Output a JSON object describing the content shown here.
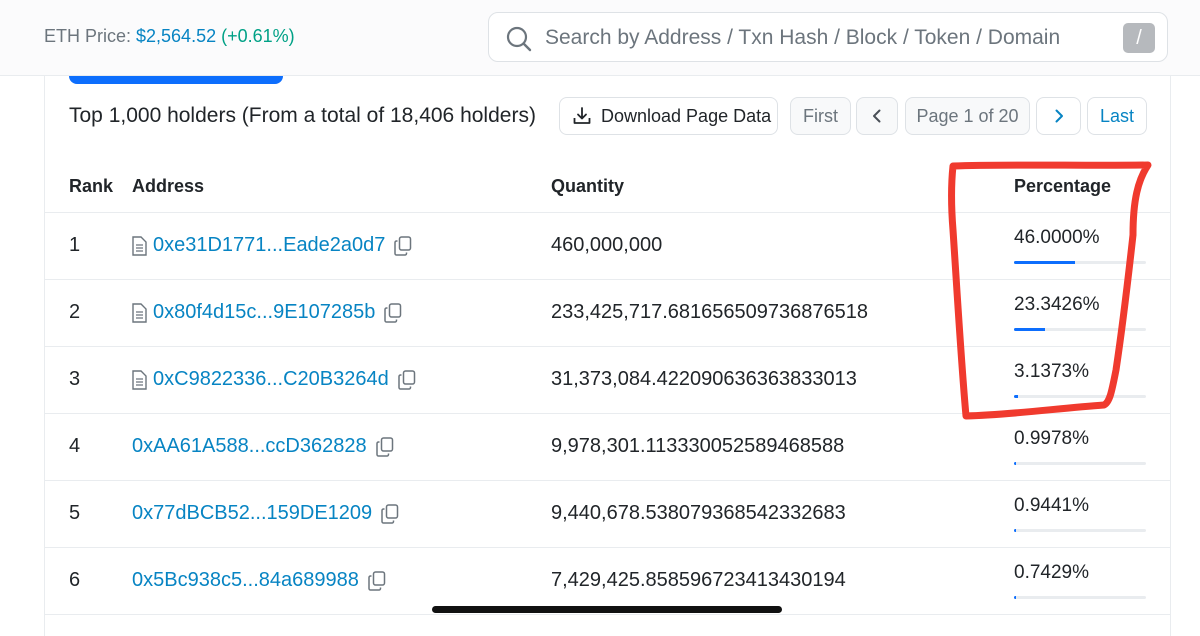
{
  "header": {
    "eth_price_label": "ETH Price: ",
    "eth_price_value": "$2,564.52",
    "eth_price_change": "(+0.61%)",
    "search_placeholder": "Search by Address / Txn Hash / Block / Token / Domain Name",
    "search_shortcut": "/"
  },
  "holders": {
    "summary": "Top 1,000 holders (From a total of 18,406 holders)",
    "download_label": "Download Page Data",
    "pagination": {
      "first": "First",
      "page_info": "Page 1 of 20",
      "last": "Last"
    },
    "columns": {
      "rank": "Rank",
      "address": "Address",
      "quantity": "Quantity",
      "percentage": "Percentage"
    },
    "rows": [
      {
        "rank": "1",
        "address": "0xe31D1771...Eade2a0d7",
        "is_contract": true,
        "quantity": "460,000,000",
        "percentage": "46.0000%",
        "pct_value": 46.0
      },
      {
        "rank": "2",
        "address": "0x80f4d15c...9E107285b",
        "is_contract": true,
        "quantity": "233,425,717.681656509736876518",
        "percentage": "23.3426%",
        "pct_value": 23.3426
      },
      {
        "rank": "3",
        "address": "0xC9822336...C20B3264d",
        "is_contract": true,
        "quantity": "31,373,084.422090636363833013",
        "percentage": "3.1373%",
        "pct_value": 3.1373
      },
      {
        "rank": "4",
        "address": "0xAA61A588...ccD362828",
        "is_contract": false,
        "quantity": "9,978,301.113330052589468588",
        "percentage": "0.9978%",
        "pct_value": 0.9978
      },
      {
        "rank": "5",
        "address": "0x77dBCB52...159DE1209",
        "is_contract": false,
        "quantity": "9,440,678.538079368542332683",
        "percentage": "0.9441%",
        "pct_value": 0.9441
      },
      {
        "rank": "6",
        "address": "0x5Bc938c5...84a689988",
        "is_contract": false,
        "quantity": "7,429,425.858596723413430194",
        "percentage": "0.7429%",
        "pct_value": 0.7429
      }
    ]
  },
  "icons": {
    "search": "search-icon",
    "download": "download-icon",
    "prev": "chevron-left-icon",
    "next": "chevron-right-icon",
    "contract": "document-icon",
    "copy": "copy-icon"
  },
  "colors": {
    "link": "#0784c3",
    "accent": "#0d6efd",
    "positive": "#00a186",
    "annotation": "#f03a2e"
  }
}
